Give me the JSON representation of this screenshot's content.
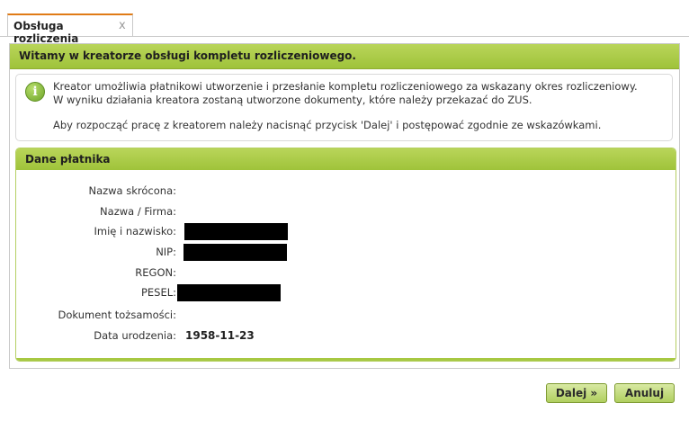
{
  "tab": {
    "label": "Obsługa rozliczenia",
    "close": "x"
  },
  "header": {
    "title": "Witamy w kreatorze obsługi kompletu rozliczeniowego."
  },
  "info": {
    "icon": "info-icon",
    "line1": "Kreator umożliwia płatnikowi utworzenie i przesłanie kompletu rozliczeniowego za wskazany okres rozliczeniowy.",
    "line2": "W wyniku działania kreatora zostaną utworzone dokumenty, które należy przekazać do ZUS.",
    "line3": "Aby rozpocząć pracę z kreatorem należy nacisnąć przycisk 'Dalej' i postępować zgodnie ze wskazówkami."
  },
  "payer": {
    "title": "Dane płatnika",
    "fields": [
      {
        "label": "Nazwa skrócona:",
        "value": ""
      },
      {
        "label": "Nazwa / Firma:",
        "value": ""
      },
      {
        "label": "Imię i nazwisko:",
        "value": ""
      },
      {
        "label": "NIP:",
        "value": ""
      },
      {
        "label": "REGON:",
        "value": ""
      },
      {
        "label": "PESEL:",
        "value": ""
      },
      {
        "label": "Dokument tożsamości:",
        "value": ""
      },
      {
        "label": "Data urodzenia:",
        "value": "1958-11-23"
      }
    ]
  },
  "buttons": {
    "next": "Dalej »",
    "cancel": "Anuluj"
  },
  "colors": {
    "accent_green": "#a7c842",
    "tab_accent": "#e07b16"
  }
}
